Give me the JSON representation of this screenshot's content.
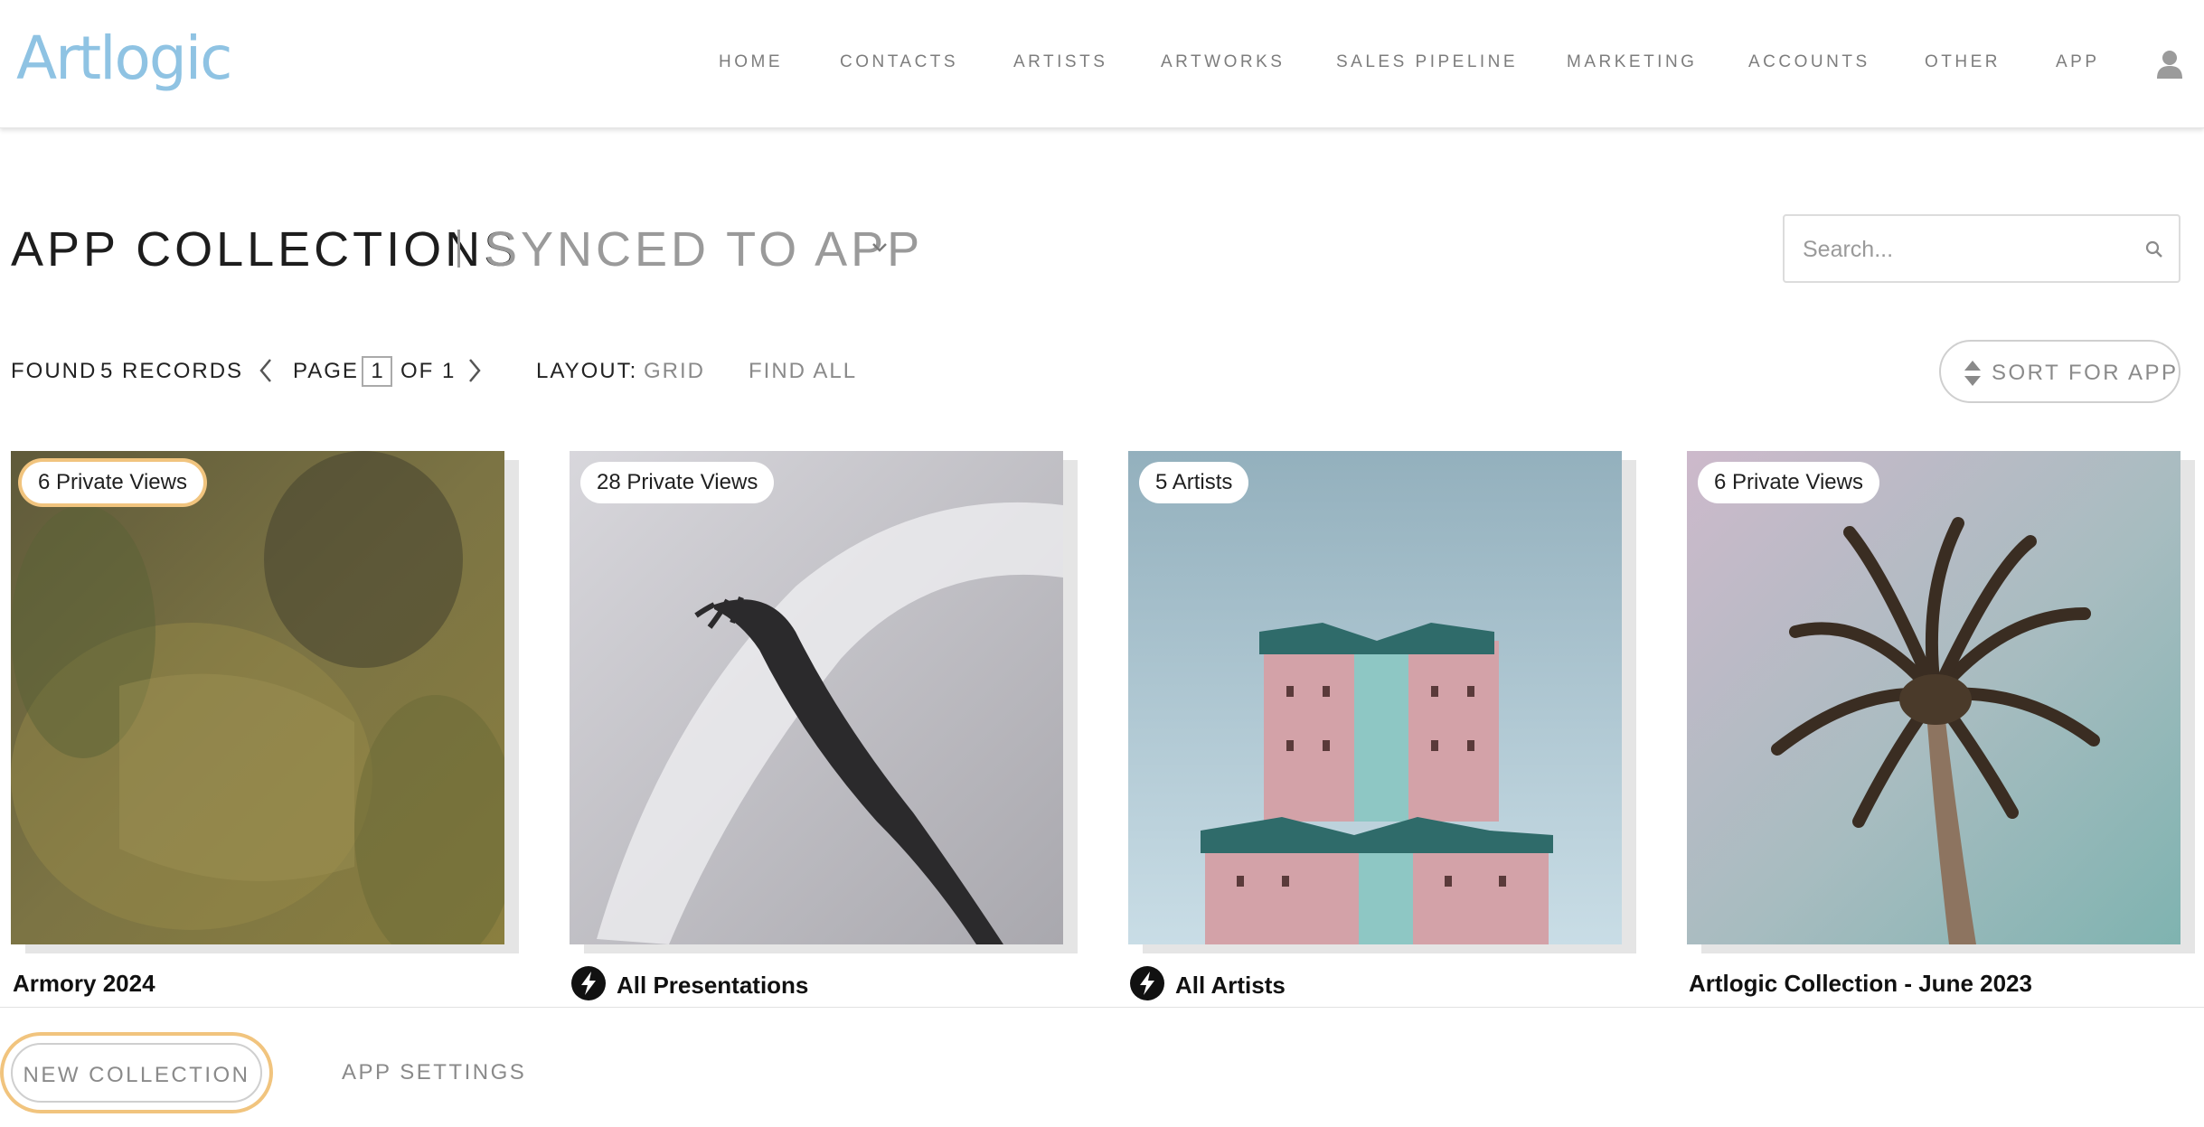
{
  "header": {
    "logo": "Artlogic",
    "nav": [
      "HOME",
      "CONTACTS",
      "ARTISTS",
      "ARTWORKS",
      "SALES PIPELINE",
      "MARKETING",
      "ACCOUNTS",
      "OTHER",
      "APP"
    ],
    "user_icon": "user-icon"
  },
  "page": {
    "title": "APP COLLECTIONS",
    "subtitle": "SYNCED TO APP",
    "search_placeholder": "Search..."
  },
  "toolbar": {
    "found_label": "FOUND",
    "found_count": "5 RECORDS",
    "page_label": "PAGE",
    "page_current": "1",
    "page_of": "OF 1",
    "layout_label": "LAYOUT:",
    "layout_value": "GRID",
    "find_all": "FIND ALL",
    "sort_label": "SORT FOR APP"
  },
  "collections": [
    {
      "badge": "6 Private Views",
      "name": "Armory 2024",
      "smart": false
    },
    {
      "badge": "28 Private Views",
      "name": "All Presentations",
      "smart": true
    },
    {
      "badge": "5 Artists",
      "name": "All Artists",
      "smart": true
    },
    {
      "badge": "6 Private Views",
      "name": "Artlogic Collection - June 2023",
      "smart": false
    }
  ],
  "footer": {
    "new_collection": "NEW COLLECTION",
    "app_settings": "APP SETTINGS"
  },
  "colors": {
    "logo": "#8fc3e3",
    "highlight": "#f1c47e",
    "muted_text": "#8a8a8a"
  }
}
